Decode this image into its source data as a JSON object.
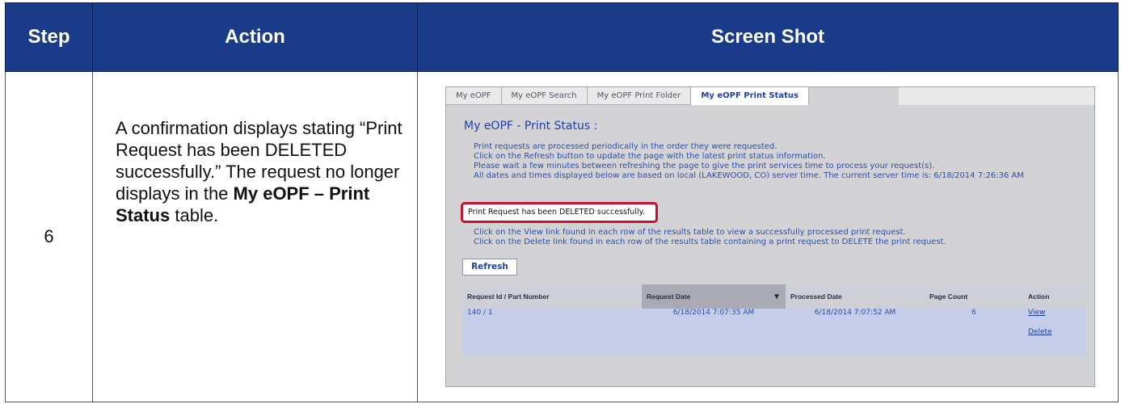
{
  "headers": {
    "step": "Step",
    "action": "Action",
    "screenshot": "Screen Shot"
  },
  "row": {
    "step": "6",
    "action_part1": "A confirmation displays stating “Print Request has been DELETED successfully.” The request no longer displays in the ",
    "action_bold": "My eOPF – Print Status",
    "action_part2": " table."
  },
  "screenshot": {
    "tabs": [
      "My eOPF",
      "My eOPF Search",
      "My eOPF Print Folder",
      "My eOPF Print Status"
    ],
    "page_title": "My eOPF - Print Status :",
    "info_lines": [
      "Print requests are processed periodically in the order they were requested.",
      "Click on the Refresh button to update the page with the latest print status information.",
      "Please wait a few minutes between refreshing the page to give the print services time to process your request(s).",
      "All dates and times displayed below are based on local (LAKEWOOD, CO) server time. The current server time is: 6/18/2014 7:26:36 AM"
    ],
    "confirmation": "Print Request has been DELETED successfully.",
    "info2_lines": [
      "Click on the View link found in each row of the results table to view a successfully processed print request.",
      "Click on the Delete link found in each row of the results table containing a print request to DELETE the print request."
    ],
    "refresh_label": "Refresh",
    "columns": [
      "Request Id / Part Number",
      "Request Date",
      "Processed Date",
      "Page Count",
      "Action"
    ],
    "rows": [
      {
        "id": "140 / 1",
        "request_date": "6/18/2014 7:07:35 AM",
        "processed_date": "6/18/2014 7:07:52 AM",
        "page_count": "6",
        "view": "View",
        "delete": "Delete"
      }
    ]
  }
}
